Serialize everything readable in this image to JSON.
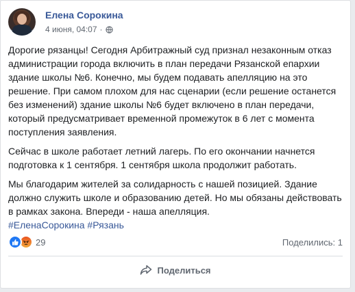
{
  "post": {
    "author": "Елена Сорокина",
    "date": "4 июня, 04:07",
    "separator": "·",
    "privacy_icon": "globe-icon",
    "paragraphs": [
      "Дорогие рязанцы! Сегодня Арбитражный суд признал незаконным отказ администрации города включить в план передачи Рязанской епархии здание школы №6. Конечно, мы будем подавать апелляцию на это решение. При самом плохом для нас сценарии (если решение останется без изменений) здание школы №6 будет включено в план передачи, который предусматривает временной промежуток в 6 лет с момента поступления заявления.",
      "Сейчас в школе работает летний лагерь. По его окончании начнется подготовка к 1 сентября. 1 сентября школа продолжит работать.",
      "Мы благодарим жителей за солидарность с нашей позицией. Здание должно служить школе и образованию детей. Но мы обязаны действовать в рамках закона. Впереди - наша апелляция."
    ],
    "hashtags": [
      "#ЕленаСорокина",
      "#Рязань"
    ]
  },
  "reactions": {
    "icons": [
      "like-icon",
      "angry-icon"
    ],
    "count": "29",
    "shares_text": "Поделились: 1"
  },
  "actions": {
    "share_label": "Поделиться",
    "share_icon": "share-arrow-icon"
  },
  "colors": {
    "link": "#385898",
    "text": "#1c1e21",
    "meta": "#606770",
    "like": "#2078f4"
  }
}
